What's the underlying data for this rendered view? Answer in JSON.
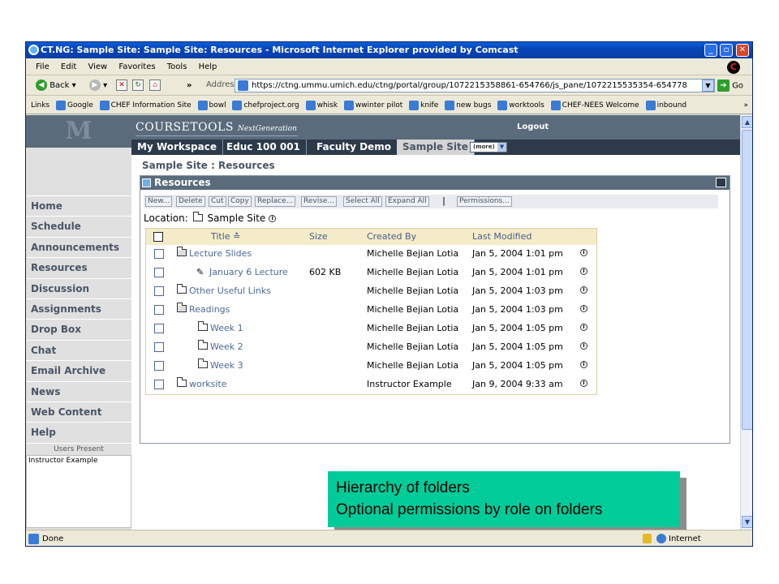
{
  "window": {
    "title": "CT.NG: Sample Site: Sample Site: Resources - Microsoft Internet Explorer provided by Comcast"
  },
  "menubar": [
    "File",
    "Edit",
    "View",
    "Favorites",
    "Tools",
    "Help"
  ],
  "toolbar": {
    "back_label": "Back",
    "chevron": "»",
    "address_label": "Address",
    "url": "https://ctng.ummu.umich.edu/ctng/portal/group/1072215358861-654766/js_pane/1072215535354-654778",
    "go_label": "Go"
  },
  "links_bar": {
    "label": "Links",
    "items": [
      "Google",
      "CHEF Information Site",
      "bowl",
      "chefproject.org",
      "whisk",
      "wwinter pilot",
      "knife",
      "new bugs",
      "worktools",
      "CHEF-NEES Welcome",
      "inbound"
    ],
    "more": "»"
  },
  "status": {
    "text": "Done",
    "zone": "Internet"
  },
  "header": {
    "logo": "M",
    "brand": "COURSETOOLS",
    "brand_sub": "NextGeneration",
    "logout": "Logout"
  },
  "tabs": [
    "My Workspace",
    "Educ 100 001",
    "Faculty Demo",
    "Sample Site"
  ],
  "more_select": "(more)",
  "sidebar": {
    "items": [
      "Home",
      "Schedule",
      "Announcements",
      "Resources",
      "Discussion",
      "Assignments",
      "Drop Box",
      "Chat",
      "Email Archive",
      "News",
      "Web Content",
      "Help"
    ],
    "users_present_label": "Users Present",
    "users": [
      "Instructor Example"
    ]
  },
  "breadcrumb": "Sample Site : Resources",
  "portlet": {
    "title": "Resources",
    "actions": [
      "New...",
      "Delete",
      "Cut",
      "Copy",
      "Replace...",
      "Revise...",
      "Select All",
      "Expand All",
      "|",
      "Permissions..."
    ],
    "location_label": "Location:",
    "location_value": "Sample Site",
    "columns": [
      "Title",
      "Size",
      "Created By",
      "Last Modified"
    ],
    "sort_indicator": "≛",
    "rows": [
      {
        "title": "Lecture Slides",
        "size": "",
        "created_by": "Michelle Bejian Lotia",
        "modified": "Jan 5, 2004 1:01 pm",
        "type": "folder-open",
        "level": 0
      },
      {
        "title": "January 6 Lecture",
        "size": "602 KB",
        "created_by": "Michelle Bejian Lotia",
        "modified": "Jan 5, 2004 1:01 pm",
        "type": "file",
        "level": 1
      },
      {
        "title": "Other Useful Links",
        "size": "",
        "created_by": "Michelle Bejian Lotia",
        "modified": "Jan 5, 2004 1:03 pm",
        "type": "folder",
        "level": 0
      },
      {
        "title": "Readings",
        "size": "",
        "created_by": "Michelle Bejian Lotia",
        "modified": "Jan 5, 2004 1:03 pm",
        "type": "folder-open",
        "level": 0
      },
      {
        "title": "Week 1",
        "size": "",
        "created_by": "Michelle Bejian Lotia",
        "modified": "Jan 5, 2004 1:05 pm",
        "type": "folder",
        "level": 1
      },
      {
        "title": "Week 2",
        "size": "",
        "created_by": "Michelle Bejian Lotia",
        "modified": "Jan 5, 2004 1:05 pm",
        "type": "folder",
        "level": 1
      },
      {
        "title": "Week 3",
        "size": "",
        "created_by": "Michelle Bejian Lotia",
        "modified": "Jan 5, 2004 1:05 pm",
        "type": "folder",
        "level": 1
      },
      {
        "title": "worksite",
        "size": "",
        "created_by": "Instructor Example",
        "modified": "Jan 9, 2004 9:33 am",
        "type": "folder",
        "level": 0
      }
    ]
  },
  "callout": {
    "lines": [
      "Hierarchy of folders",
      "Optional permissions by role on folders"
    ]
  },
  "colors": {
    "header": "#5a6b7c",
    "tabs_bg": "#2c3a4a",
    "sidebar": "#e0e0e0",
    "table_header": "#f4ecc8",
    "link": "#4a6a9a",
    "callout": "#00cc99"
  }
}
